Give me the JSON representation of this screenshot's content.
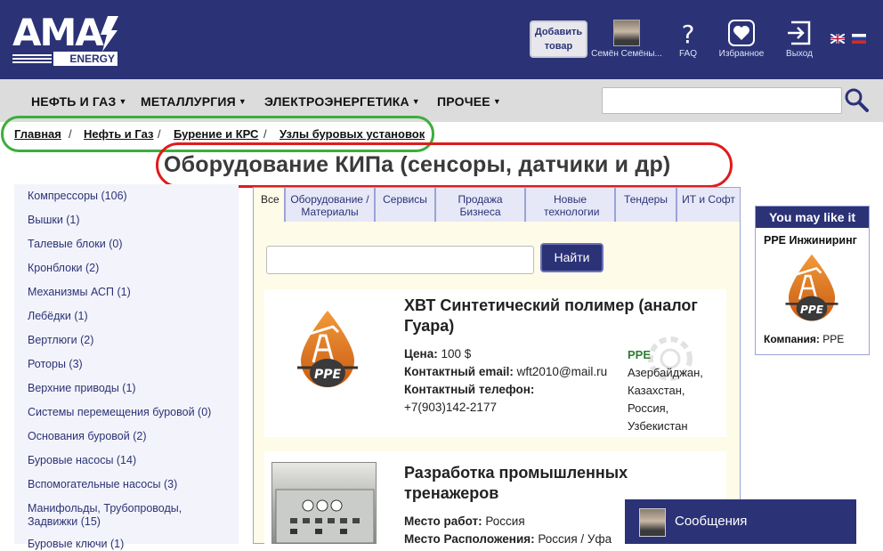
{
  "header": {
    "logo_main": "AMA",
    "logo_sub": "ENERGY",
    "add_product": [
      "Добавить",
      "товар"
    ],
    "user_name": "Семён Семёны...",
    "faq": "FAQ",
    "favorites": "Избранное",
    "logout": "Выход",
    "languages": [
      "en",
      "ru"
    ]
  },
  "nav": {
    "items": [
      "НЕФТЬ И ГАЗ",
      "МЕТАЛЛУРГИЯ",
      "ЭЛЕКТРОЭНЕРГЕТИКА",
      "ПРОЧЕЕ"
    ],
    "search_value": ""
  },
  "breadcrumb": [
    "Главная",
    "Нефть и Газ",
    "Бурение и КРС",
    "Узлы буровых установок"
  ],
  "page_title": "Оборудование КИПа (сенсоры, датчики и др)",
  "sidebar": {
    "items": [
      "Компрессоры (106)",
      "Вышки (1)",
      "Талевые блоки (0)",
      "Кронблоки (2)",
      "Механизмы АСП (1)",
      "Лебёдки (1)",
      "Вертлюги (2)",
      "Роторы (3)",
      "Верхние приводы (1)",
      "Системы перемещения буровой (0)",
      "Основания буровой (2)",
      "Буровые насосы (14)",
      "Вспомогательные насосы (3)",
      "Манифольды, Трубопроводы, Задвижки (15)",
      "Буровые ключи (1)"
    ]
  },
  "tabs": [
    "Все",
    "Оборудование / Материалы",
    "Сервисы",
    "Продажа Бизнеса",
    "Новые технологии",
    "Тендеры",
    "ИТ и Софт"
  ],
  "filter": {
    "value": "",
    "button": "Найти"
  },
  "listings": [
    {
      "title": "ХВТ Синтетический полимер (аналог Гуара)",
      "fields": [
        {
          "label": "Цена:",
          "value": "100 $"
        },
        {
          "label": "Контактный email:",
          "value": "wft2010@mail.ru"
        },
        {
          "label": "Контактный телефон:",
          "value": ""
        },
        {
          "label": "",
          "value": "+7(903)142-2177"
        }
      ],
      "company": "PPE",
      "regions": [
        "Азербайджан,",
        "Казахстан,",
        "Россия,",
        "Узбекистан"
      ],
      "logo_text": "PPE"
    },
    {
      "title": "Разработка промышленных тренажеров",
      "fields": [
        {
          "label": "Место работ:",
          "value": "Россия"
        },
        {
          "label": "Место Расположения:",
          "value": "Россия / Уфа"
        }
      ]
    }
  ],
  "you_may_like": {
    "heading": "You may like it",
    "name": "PPE Инжиниринг",
    "company_label": "Компания:",
    "company_value": "PPE",
    "logo_text": "PPE"
  },
  "messages": {
    "label": "Сообщения"
  },
  "colors": {
    "brand": "#2b3276",
    "highlight_green": "#3cae3c",
    "highlight_red": "#e01b1b",
    "panel": "#fefce8"
  }
}
